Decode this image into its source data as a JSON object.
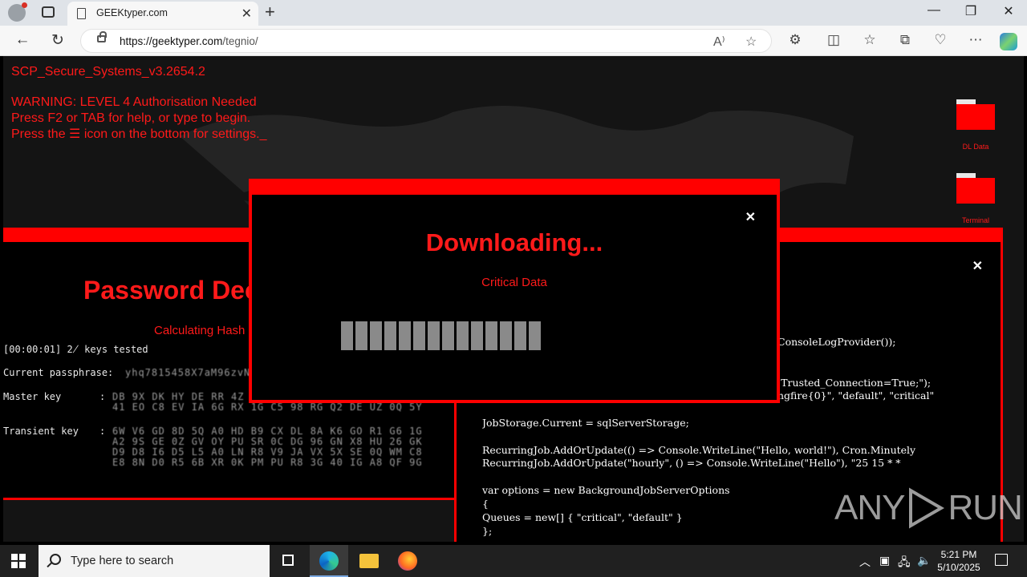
{
  "browser": {
    "tab_title": "GEEKtyper.com",
    "url_host": "https://geektyper.com",
    "url_path": "/tegnio/"
  },
  "page": {
    "header_line1": "SCP_Secure_Systems_v3.2654.2",
    "header_line2": "WARNING: LEVEL 4 Authorisation Needed",
    "header_line3": "Press F2 or TAB for help, or type to begin.",
    "header_line4": "Press the ☰ icon on the bottom for settings._",
    "desktop_icons": [
      {
        "label": "DL Data"
      },
      {
        "label": "Terminal"
      }
    ],
    "password_window": {
      "title": "Password Dec",
      "subtitle": "Calculating Hash",
      "keys_tested": "[00:00:01] 2̸ keys tested",
      "passphrase_label": "Current passphrase:",
      "passphrase_value": "yhq7815458X7aM96zvN",
      "master_label": "Master key",
      "master_lines": [
        "DB 9X DK HY DE RR 4Z 9D",
        "41 EO C8 EV IA 6G RX 1G C5 98 RG Q2 DE UZ 0Q 5Y"
      ],
      "transient_label": "Transient key",
      "transient_lines": [
        "6W V6 GD 8D 5Q A0 HD B9 CX DL 8A K6 GO R1 G6 1G",
        "A2 9S GE 0Z GV OY PU SR 0C DG 96 GN X8 HU 26 GK",
        "D9 D8 I6 D5 L5 A0 LN R8 V9 JA VX 5X SE 0Q WM C8",
        "E8 8N D0 R5 6B XR 0K PM PU R8 3G 40 IG A8 QF 9G"
      ]
    },
    "code_window": {
      "lines": [
        "ConsoleLogProvider());",
        ";Trusted_Connection=True;\");",
        "ngfire{0}\", \"default\", \"critical\"",
        "JobStorage.Current = sqlServerStorage;",
        "RecurringJob.AddOrUpdate(() => Console.WriteLine(\"Hello, world!\"), Cron.Minutely",
        "RecurringJob.AddOrUpdate(\"hourly\", () => Console.WriteLine(\"Hello\"), \"25 15 * *",
        "var options = new BackgroundJobServerOptions",
        "{",
        "Queues = new[] { \"critical\", \"default\" }",
        "};"
      ]
    },
    "download_dialog": {
      "title": "Downloading...",
      "subtitle": "Critical Data",
      "progress_segments": 14,
      "progress_total": 14
    },
    "watermark": {
      "left": "ANY",
      "right": "RUN"
    }
  },
  "taskbar": {
    "search_placeholder": "Type here to search",
    "time": "5:21 PM",
    "date": "5/10/2025"
  },
  "colors": {
    "accent_red": "#ff0000",
    "text_red": "#ff1a1a",
    "page_bg": "#141414"
  }
}
